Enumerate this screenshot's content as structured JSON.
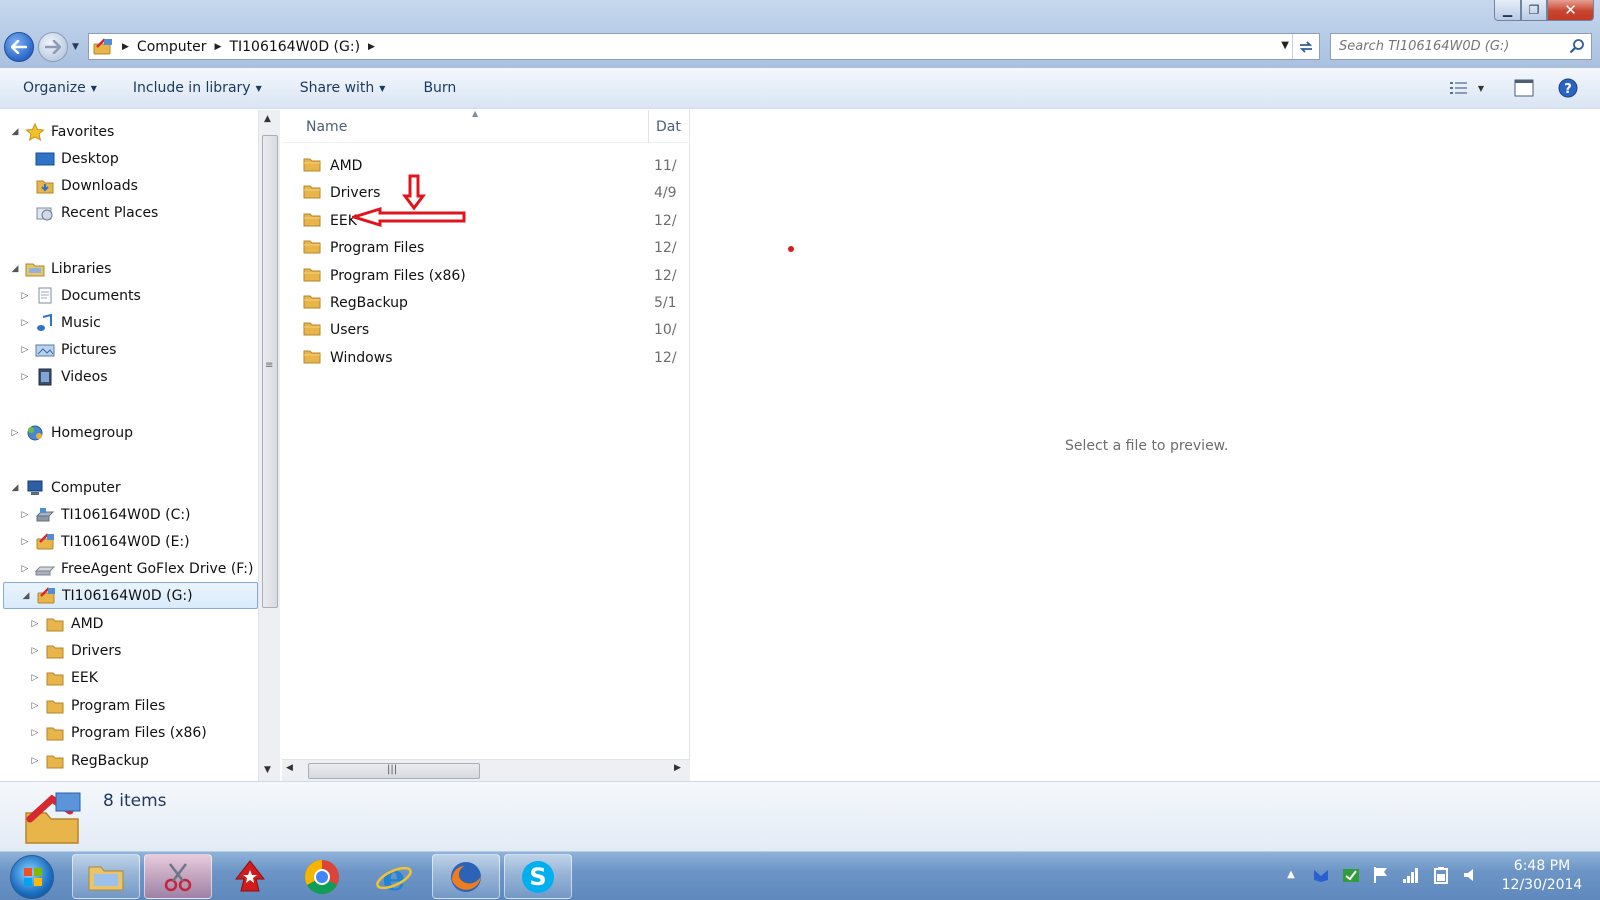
{
  "window": {
    "controls": {
      "minimize": "▁",
      "maximize": "❐",
      "close": "✕"
    }
  },
  "address_bar": {
    "breadcrumbs": [
      "Computer",
      "TI106164W0D (G:)"
    ]
  },
  "search": {
    "placeholder": "Search TI106164W0D (G:)"
  },
  "toolbar": {
    "organize": "Organize",
    "include_in_library": "Include in library",
    "share_with": "Share with",
    "burn": "Burn"
  },
  "nav_pane": {
    "favorites": {
      "label": "Favorites",
      "items": [
        "Desktop",
        "Downloads",
        "Recent Places"
      ]
    },
    "libraries": {
      "label": "Libraries",
      "items": [
        "Documents",
        "Music",
        "Pictures",
        "Videos"
      ]
    },
    "homegroup": {
      "label": "Homegroup"
    },
    "computer": {
      "label": "Computer",
      "drives": [
        "TI106164W0D (C:)",
        "TI106164W0D (E:)",
        "FreeAgent GoFlex Drive (F:)",
        "TI106164W0D (G:)"
      ],
      "selected_drive_children": [
        "AMD",
        "Drivers",
        "EEK",
        "Program Files",
        "Program Files (x86)",
        "RegBackup"
      ]
    }
  },
  "file_list": {
    "columns": {
      "name": "Name",
      "date": "Dat"
    },
    "rows": [
      {
        "name": "AMD",
        "date": "11/"
      },
      {
        "name": "Drivers",
        "date": "4/9"
      },
      {
        "name": "EEK",
        "date": "12/"
      },
      {
        "name": "Program Files",
        "date": "12/"
      },
      {
        "name": "Program Files (x86)",
        "date": "12/"
      },
      {
        "name": "RegBackup",
        "date": "5/1"
      },
      {
        "name": "Users",
        "date": "10/"
      },
      {
        "name": "Windows",
        "date": "12/"
      }
    ]
  },
  "preview": {
    "message": "Select a file to preview."
  },
  "details": {
    "item_count": "8 items"
  },
  "taskbar": {
    "clock_time": "6:48 PM",
    "clock_date": "12/30/2014"
  },
  "colors": {
    "folder": "#e8b54a",
    "annotation": "#e0141c",
    "accent": "#1e395b"
  }
}
